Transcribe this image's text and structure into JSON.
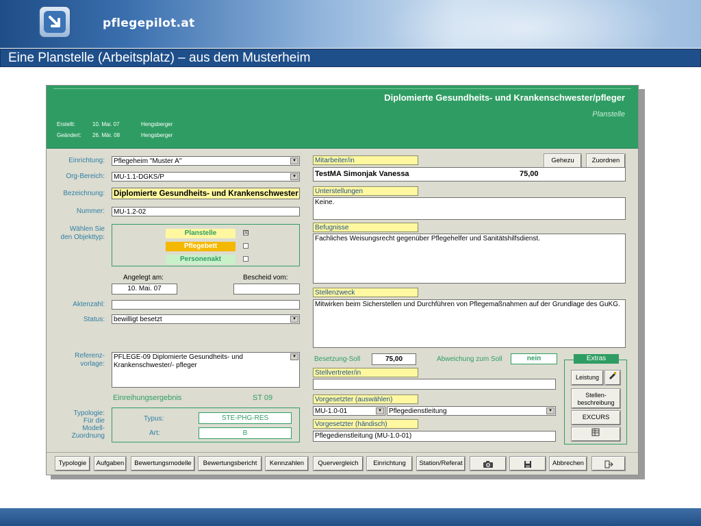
{
  "banner": {
    "brand": "pflegepilot.at"
  },
  "slide_title": "Eine Planstelle (Arbeitsplatz) – aus dem Musterheim",
  "header": {
    "title": "Diplomierte Gesundheits- und Krankenschwester/pfleger",
    "subtitle": "Planstelle",
    "created_label": "Erstellt:",
    "created_date": "10. Mai. 07",
    "created_by": "Hengsberger",
    "changed_label": "Geändert:",
    "changed_date": "26. Mär. 08",
    "changed_by": "Hengsberger"
  },
  "left": {
    "einrichtung_label": "Einrichtung:",
    "einrichtung_value": "Pflegeheim \"Muster A\"",
    "org_label": "Org-Bereich:",
    "org_value": "MU-1.1-DGKS/P",
    "bezeichnung_label": "Bezeichnung:",
    "bezeichnung_value": "Diplomierte Gesundheits- und Krankenschwester",
    "nummer_label": "Nummer:",
    "nummer_value": "MU-1.2-02",
    "objekttyp_label1": "Wählen Sie",
    "objekttyp_label2": "den Objekttyp:",
    "objekttypen": [
      {
        "label": "Planstelle",
        "checked": "☒",
        "color": "#fff8a0"
      },
      {
        "label": "Pflegebett",
        "checked": "",
        "color": "#f5b800"
      },
      {
        "label": "Personenakt",
        "checked": "",
        "color": "#c9f0c9"
      }
    ],
    "angelegt_label": "Angelegt am:",
    "angelegt_value": "10. Mai. 07",
    "bescheid_label": "Bescheid vom:",
    "bescheid_value": "",
    "aktenzahl_label": "Aktenzahl:",
    "aktenzahl_value": "",
    "status_label": "Status:",
    "status_value": "bewilligt besetzt",
    "referenz_label1": "Referenz-",
    "referenz_label2": "vorlage:",
    "referenz_value": "PFLEGE-09 Diplomierte Gesundheits- und Krankenschwester/- pfleger",
    "einreihung_label": "Einreihungsergebnis",
    "einreihung_value": "ST 09",
    "typologie_label": [
      "Typologie:",
      "Für die",
      "Modell-",
      "Zuordnung"
    ],
    "typus_label": "Typus:",
    "typus_value": "STE-PHG-RES",
    "art_label": "Art:",
    "art_value": "B"
  },
  "right": {
    "mitarbeiter_label": "Mitarbeiter/in",
    "gehezu_button": "Gehezu",
    "zuordnen_button": "Zuordnen",
    "mitarbeiter_name": "TestMA Simonjak Vanessa",
    "mitarbeiter_value": "75,00",
    "unterstellungen_label": "Unterstellungen",
    "unterstellungen_value": "Keine.",
    "befugnisse_label": "Befugnisse",
    "befugnisse_value": "Fachliches Weisungsrecht gegenüber Pflegehelfer und Sanitätshilfsdienst.",
    "stellenzweck_label": "Stellenzweck",
    "stellenzweck_value": "Mitwirken beim Sicherstellen und Durchführen von Pflegemaßnahmen auf der Grundlage des GuKG.",
    "besetzung_label": "Besetzung-Soll",
    "besetzung_value": "75,00",
    "abweichung_label": "Abweichung zum Soll",
    "abweichung_value": "nein",
    "stellvertreter_label": "Stellvertreter/in",
    "stellvertreter_value": "",
    "vorgesetzter_label": "Vorgesetzter (auswählen)",
    "vorgesetzter_code": "MU-1.0-01",
    "vorgesetzter_name": "Pflegedienstleitung",
    "vorgesetzter_h_label": "Vorgesetzter (händisch)",
    "vorgesetzter_h_value": "Pflegedienstleitung (MU-1.0-01)",
    "extras_label": "Extras",
    "leistung_button": "Leistung",
    "stellenbeschreibung_button1": "Stellen-",
    "stellenbeschreibung_button2": "beschreibung",
    "excurs_button": "EXCURS"
  },
  "bottom_buttons": [
    "Typologie",
    "Aufgaben",
    "Bewertungsmodelle",
    "Bewertungsbericht",
    "Kennzahlen",
    "Quervergleich",
    "Einrichtung",
    "Station/Referat",
    "",
    "",
    "Abbrechen",
    ""
  ]
}
